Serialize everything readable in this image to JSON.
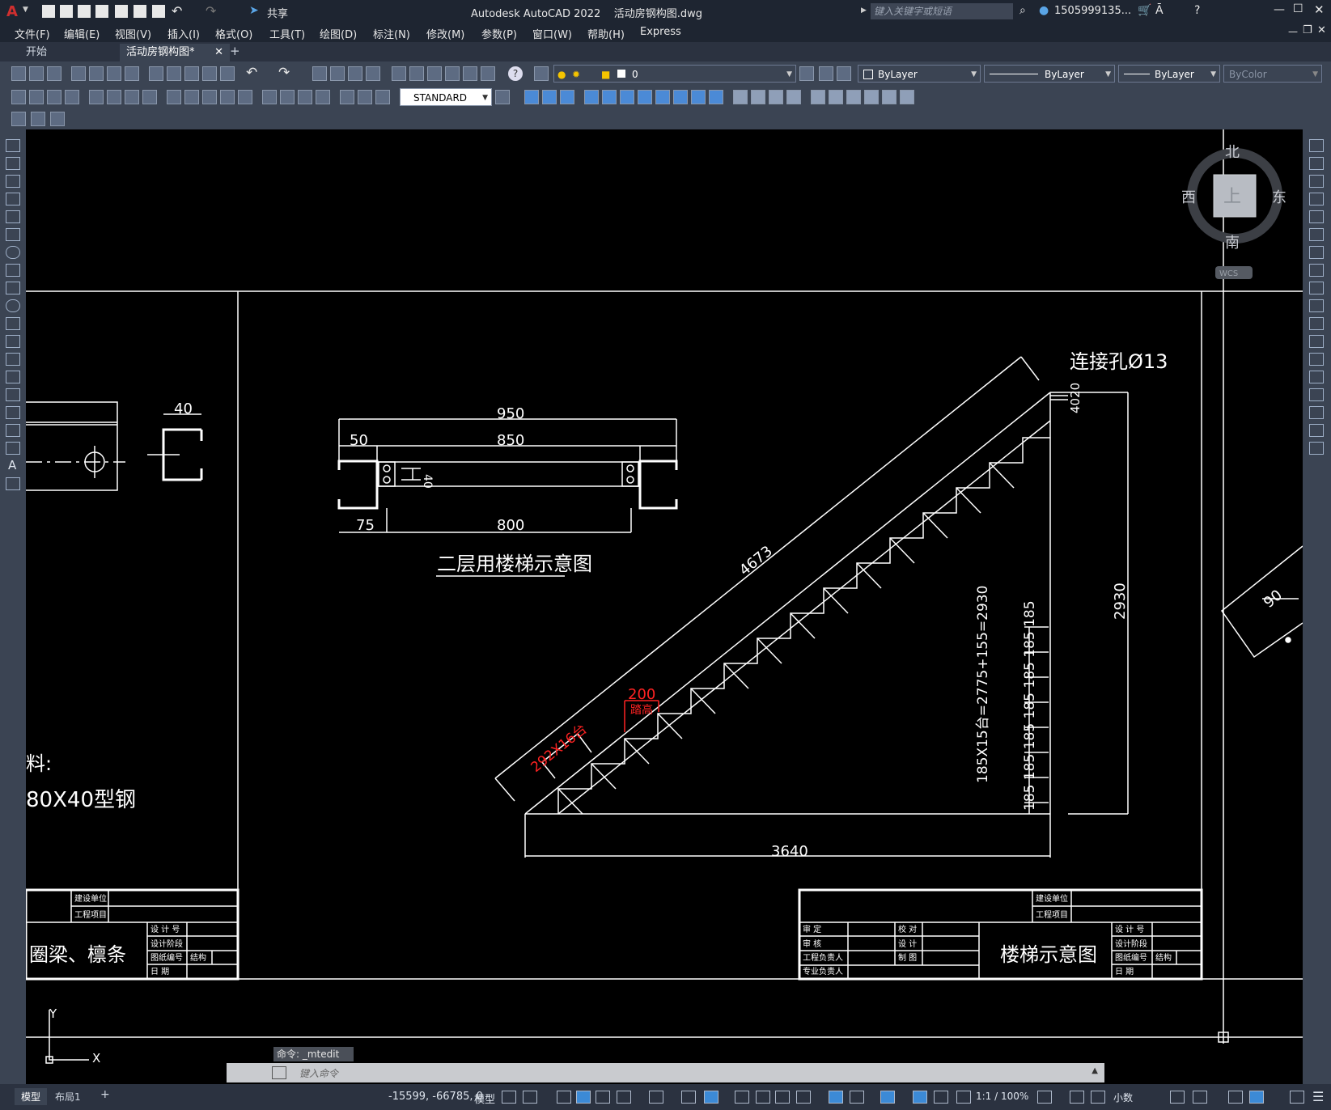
{
  "window": {
    "title": "Autodesk AutoCAD 2022    活动房钢构图.dwg",
    "search_placeholder": "键入关键字或短语",
    "user": "1505999135...",
    "share_label": "共享"
  },
  "menu": [
    "文件(F)",
    "编辑(E)",
    "视图(V)",
    "插入(I)",
    "格式(O)",
    "工具(T)",
    "绘图(D)",
    "标注(N)",
    "修改(M)",
    "参数(P)",
    "窗口(W)",
    "帮助(H)",
    "Express"
  ],
  "tabs": [
    {
      "label": "开始"
    },
    {
      "label": "活动房钢构图*"
    }
  ],
  "toolbar": {
    "layer_value": "0",
    "color_value": "ByLayer",
    "linetype_value": "ByLayer",
    "lineweight_value": "ByLayer",
    "plotstyle_value": "ByColor",
    "dimstyle_value": "STANDARD"
  },
  "viewcube": {
    "north": "北",
    "south": "南",
    "east": "东",
    "west": "西",
    "top": "上",
    "wcs": "WCS"
  },
  "drawing": {
    "left_dim_40": "40",
    "left_text_material": "料:",
    "left_text_steel": "80X40型钢",
    "stair_plan": {
      "dim_950": "950",
      "dim_50": "50",
      "dim_850": "850",
      "dim_40": "40",
      "dim_75": "75",
      "dim_800": "800",
      "caption": "二层用楼梯示意图"
    },
    "stair_side": {
      "hole_label": "连接孔Ø13",
      "dim_4020": "4020",
      "dim_4673": "4673",
      "dim_2930": "2930",
      "dim_3640": "3640",
      "step_formula": "185X15台=2775+155=2930",
      "riser_dims": "185 185 185 185 185 185 185",
      "red_200": "200",
      "red_tread": "踏高",
      "red_292": "292X16台"
    },
    "right_dim_90": "90",
    "titleblock_left": {
      "r1": "建设单位",
      "r2": "工程项目",
      "design_no": "设 计 号",
      "design_stage": "设计阶段",
      "drawing_no": "图纸编号",
      "struct": "结构",
      "date": "日    期",
      "name": "圈梁、檩条"
    },
    "titleblock_right": {
      "r1": "建设单位",
      "r2": "工程项目",
      "approve": "审    定",
      "review": "审    核",
      "proj_lead": "工程负责人",
      "spec_lead": "专业负责人",
      "check": "校    对",
      "design": "设    计",
      "draw": "制    图",
      "name": "楼梯示意图",
      "design_no": "设 计 号",
      "design_stage": "设计阶段",
      "drawing_no": "图纸编号",
      "struct": "结构",
      "date": "日    期"
    },
    "ucs_x": "X",
    "ucs_y": "Y"
  },
  "command": {
    "history": "命令: _mtedit",
    "placeholder": "键入命令"
  },
  "status": {
    "model_tab": "模型",
    "layout_tab": "布局1",
    "coords": "-15599, -66785, 0",
    "model_label": "模型",
    "scale": "1:1 / 100%",
    "units": "小数"
  }
}
